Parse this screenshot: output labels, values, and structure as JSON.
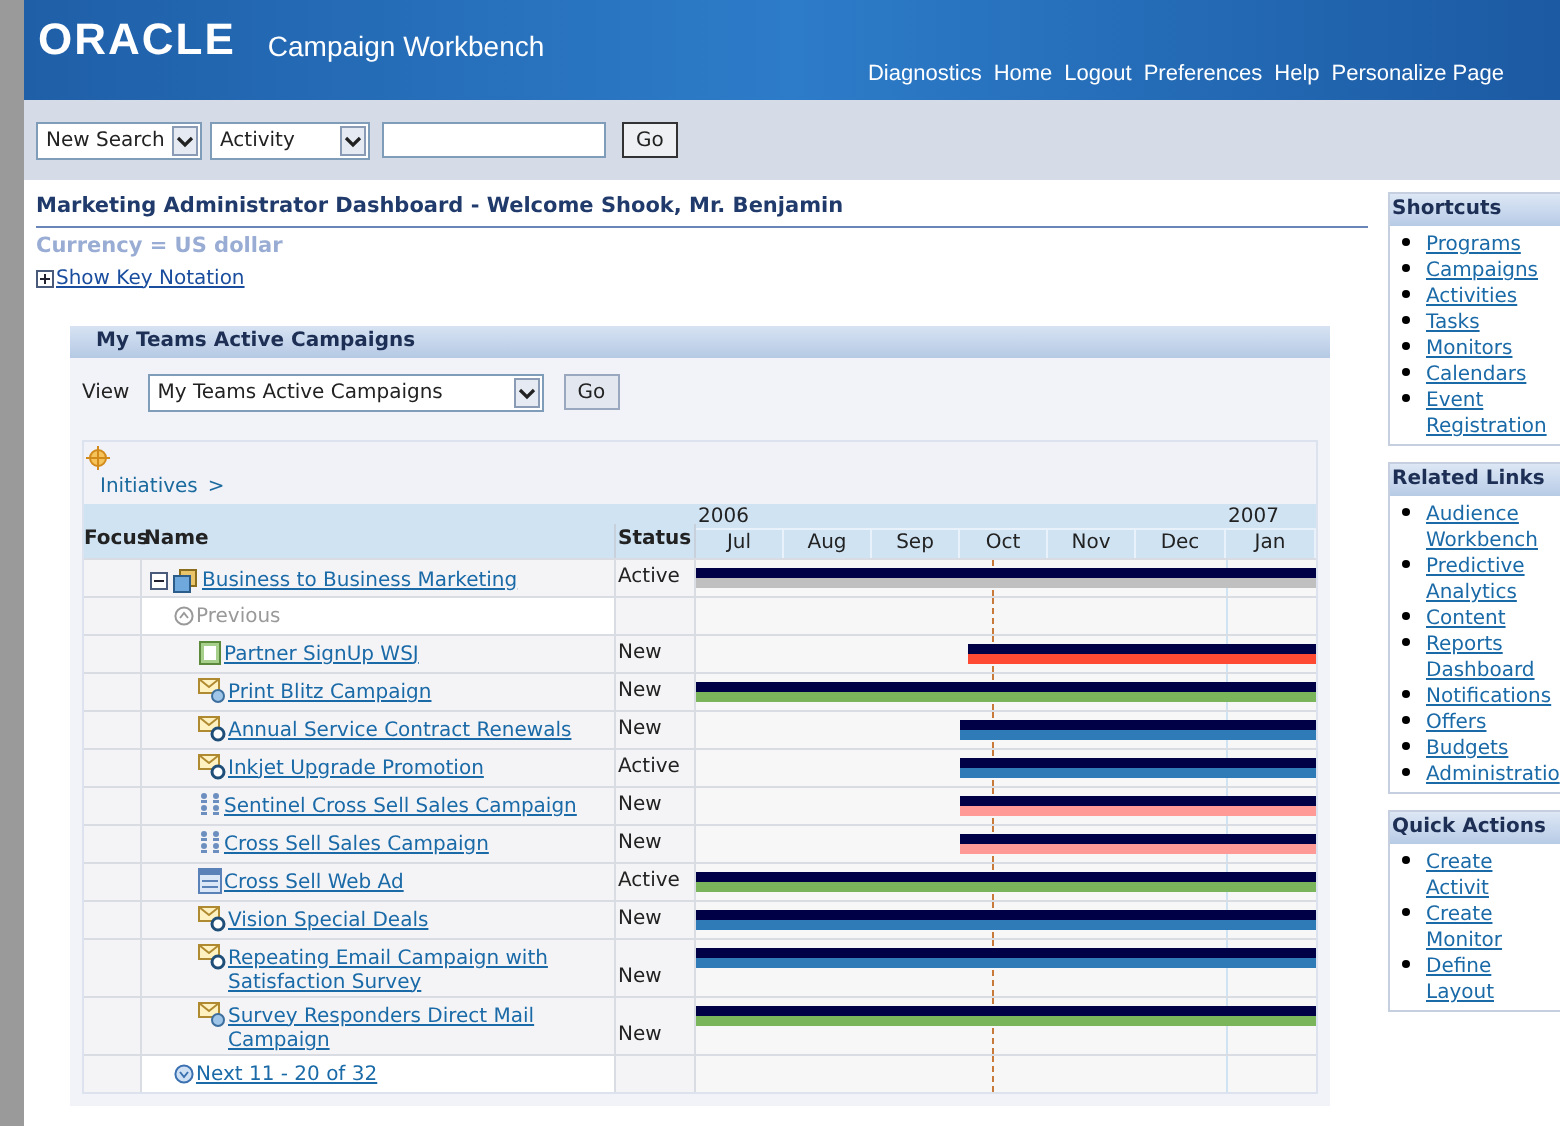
{
  "header": {
    "logo": "ORACLE",
    "app_title": "Campaign Workbench",
    "links": [
      "Diagnostics",
      "Home",
      "Logout",
      "Preferences",
      "Help",
      "Personalize Page"
    ]
  },
  "search": {
    "scope": "New Search",
    "type": "Activity",
    "button": "Go"
  },
  "page_title": "Marketing Administrator Dashboard - Welcome Shook, Mr. Benjamin",
  "currency": "Currency = US dollar",
  "key_notation": "Show Key Notation",
  "panel": {
    "title": "My Teams Active Campaigns",
    "view_label": "View",
    "view_value": "My Teams Active Campaigns",
    "go": "Go",
    "breadcrumb": "Initiatives",
    "breadcrumb_separator": ">",
    "columns": [
      "Focus",
      "Name",
      "Status"
    ],
    "years": [
      "2006",
      "2007"
    ],
    "months": [
      "Jul",
      "Aug",
      "Sep",
      "Oct",
      "Nov",
      "Dec",
      "Jan"
    ],
    "rows": [
      {
        "kind": "program",
        "name": "Business to Business Marketing",
        "status": "Active",
        "color": "#c0c0c0"
      },
      {
        "kind": "previous",
        "name": "Previous"
      },
      {
        "kind": "document",
        "name": "Partner SignUp WSJ",
        "status": "New",
        "color": "#ff4a33"
      },
      {
        "kind": "mail",
        "name": "Print Blitz Campaign",
        "status": "New",
        "color": "#7ab55c"
      },
      {
        "kind": "email",
        "name": "Annual Service Contract Renewals",
        "status": "New",
        "color": "#2e7bb8"
      },
      {
        "kind": "email",
        "name": "Inkjet Upgrade Promotion",
        "status": "Active",
        "color": "#2e7bb8"
      },
      {
        "kind": "people",
        "name": "Sentinel Cross Sell Sales Campaign",
        "status": "New",
        "color": "#ff9a96"
      },
      {
        "kind": "people",
        "name": "Cross Sell Sales Campaign",
        "status": "New",
        "color": "#ff9a96"
      },
      {
        "kind": "web",
        "name": "Cross Sell Web Ad",
        "status": "Active",
        "color": "#7ab55c"
      },
      {
        "kind": "email",
        "name": "Vision Special Deals",
        "status": "New",
        "color": "#2e7bb8"
      },
      {
        "kind": "email",
        "name": "Repeating Email Campaign with Satisfaction Survey",
        "status": "New",
        "color": "#2e7bb8"
      },
      {
        "kind": "mail",
        "name": "Survey Responders Direct Mail Campaign",
        "status": "New",
        "color": "#7ab55c"
      },
      {
        "kind": "next",
        "name": "Next 11 - 20 of 32"
      }
    ]
  },
  "sidebar": [
    {
      "title": "Shortcuts",
      "links": [
        "Programs",
        "Campaigns",
        "Activities",
        "Tasks",
        "Monitors",
        "Calendars",
        "Event Registration"
      ]
    },
    {
      "title": "Related Links",
      "links": [
        "Audience Workbench",
        "Predictive Analytics",
        "Content",
        "Reports Dashboard",
        "Notifications",
        "Offers",
        "Budgets",
        "Administratio"
      ]
    },
    {
      "title": "Quick Actions",
      "links": [
        "Create Activit",
        "Create Monitor",
        "Define Layout"
      ]
    }
  ]
}
